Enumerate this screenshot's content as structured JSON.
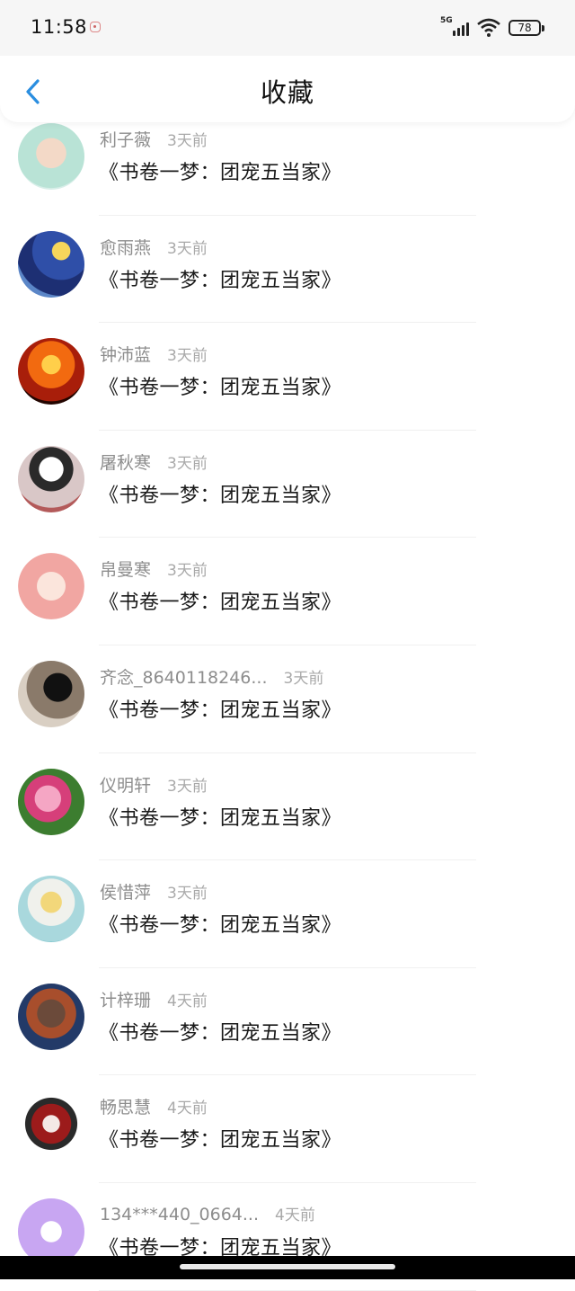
{
  "status": {
    "time": "11:58",
    "network": "5G",
    "battery": "78"
  },
  "header": {
    "title": "收藏"
  },
  "items": [
    {
      "name": "利子薇",
      "time": "3天前",
      "book": "《书卷一梦：团宠五当家》",
      "avatar_bg": "radial-gradient(circle at 50% 45%, #f3d9c7 0 30%, #b9e3d6 31% 70%, #d7eee8 71%)"
    },
    {
      "name": "愈雨燕",
      "time": "3天前",
      "book": "《书卷一梦：团宠五当家》",
      "avatar_bg": "radial-gradient(circle at 65% 30%, #f6d65b 0 14%, #2f4fa8 15% 45%, #1d2f73 46% 70%, #5b86c7 71%)"
    },
    {
      "name": "钟沛蓝",
      "time": "3天前",
      "book": "《书卷一梦：团宠五当家》",
      "avatar_bg": "radial-gradient(circle at 50% 40%, #ffcf4a 0 18%, #f26a10 19% 45%, #a81e0a 46% 70%, #230500 71%)"
    },
    {
      "name": "屠秋寒",
      "time": "3天前",
      "book": "《书卷一梦：团宠五当家》",
      "avatar_bg": "radial-gradient(circle at 50% 35%, #ffffff 0 22%, #2a2a2a 23% 40%, #d9c7c7 41% 70%, #b35a5a 71%)"
    },
    {
      "name": "帛曼寒",
      "time": "3天前",
      "book": "《书卷一梦：团宠五当家》",
      "avatar_bg": "radial-gradient(circle at 50% 50%, #fbe5dc 0 30%, #f1a6a2 31% 70%, #f7f0f0 71%)"
    },
    {
      "name": "齐念_8640118246...",
      "time": "3天前",
      "book": "《书卷一梦：团宠五当家》",
      "avatar_bg": "radial-gradient(circle at 60% 40%, #111 0 25%, #8a7a6a 26% 55%, #d9cfc3 56%)"
    },
    {
      "name": "仪明轩",
      "time": "3天前",
      "book": "《书卷一梦：团宠五当家》",
      "avatar_bg": "radial-gradient(circle at 45% 45%, #f5a6c4 0 25%, #d63f7a 26% 45%, #3c7d2f 46% 75%, #5fa64a 76%)"
    },
    {
      "name": "侯惜萍",
      "time": "3天前",
      "book": "《书卷一梦：团宠五当家》",
      "avatar_bg": "radial-gradient(circle at 50% 40%, #f2d77a 0 20%, #f0f1ec 21% 45%, #a9d8dd 46% 75%, #7cc3cc 76%)"
    },
    {
      "name": "计梓珊",
      "time": "4天前",
      "book": "《书卷一梦：团宠五当家》",
      "avatar_bg": "radial-gradient(circle at 50% 45%, #6b4a3a 0 28%, #a84e2c 29% 50%, #233a68 51% 75%, #304d86 76%)"
    },
    {
      "name": "畅思慧",
      "time": "4天前",
      "book": "《书卷一梦：团宠五当家》",
      "avatar_bg": "radial-gradient(circle at 50% 50%, #f4e9e6 0 18%, #9c1b1b 19% 42%, #2a2a2a 43% 55%, #ffffff 56%)"
    },
    {
      "name": "134***440_0664...",
      "time": "4天前",
      "book": "《书卷一梦：团宠五当家》",
      "avatar_bg": "radial-gradient(circle at 50% 50%, #ffffff 0 22%, #c8a6f2 23%)"
    }
  ]
}
